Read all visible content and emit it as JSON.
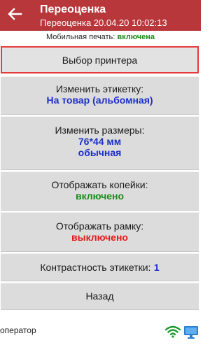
{
  "header": {
    "title": "Переоценка",
    "subtitle": "Переоценка 20.04.20 10:02:13"
  },
  "mobile_print": {
    "label": "Мобильная печать:",
    "state": "включена"
  },
  "buttons": {
    "printer": "Выбор принтера",
    "label_label": "Изменить этикетку:",
    "label_value": "На товар (альбомная)",
    "size_label": "Изменить размеры:",
    "size_value": "76*44 мм",
    "size_type": "обычная",
    "kopeks_label": "Отображать копейки:",
    "kopeks_value": "включено",
    "frame_label": "Отображать рамку:",
    "frame_value": "выключено",
    "contrast_label": "Контрастность этикетки:",
    "contrast_value": "1",
    "back": "Назад"
  },
  "footer": {
    "operator": "оператор"
  },
  "colors": {
    "header": "#b8373b",
    "accent_blue": "#1c2fc9",
    "on_green": "#1a8a1a",
    "off_red": "#e21b1b",
    "selected_border": "#e53a3a"
  },
  "icons": {
    "back": "arrow-left-icon",
    "wifi": "wifi-icon",
    "monitor": "monitor-icon"
  }
}
